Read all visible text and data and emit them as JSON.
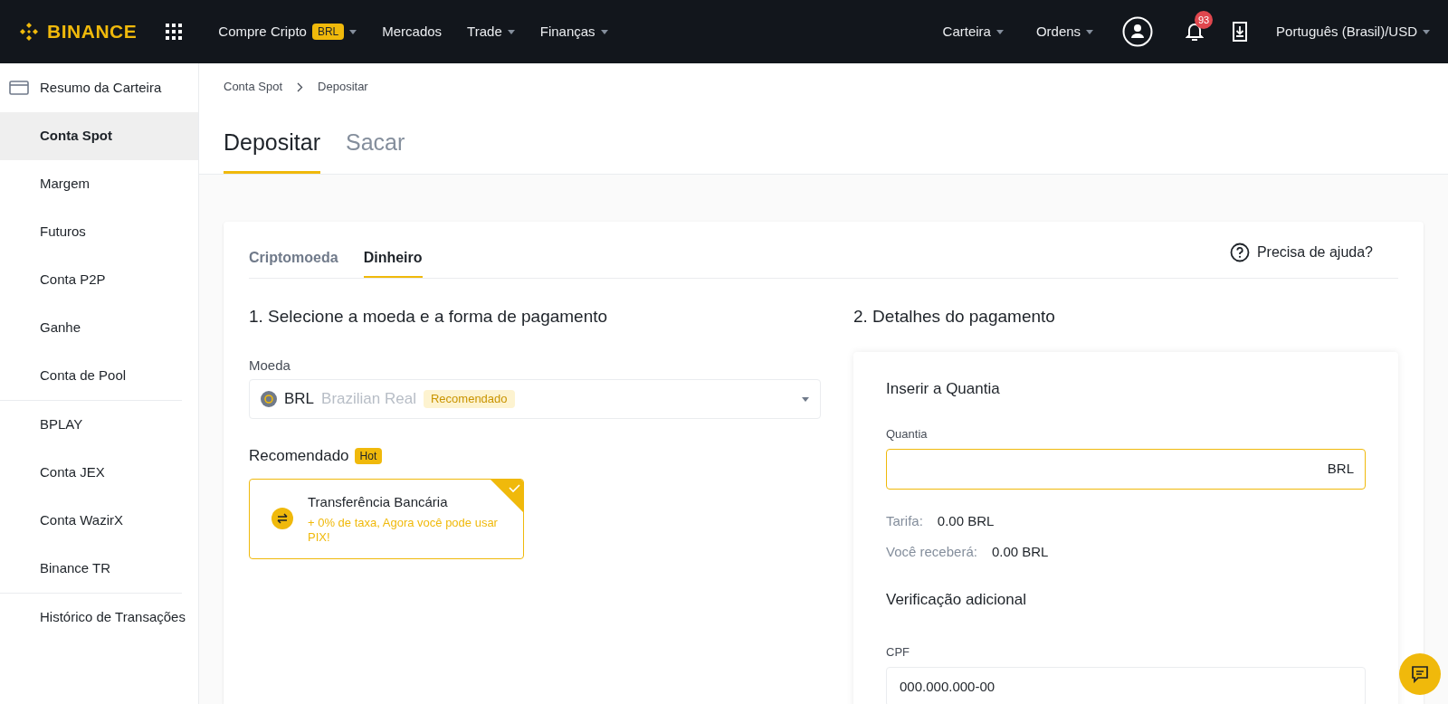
{
  "header": {
    "logo": "BINANCE",
    "nav": [
      {
        "label": "Compre Cripto",
        "badge": "BRL",
        "dropdown": true
      },
      {
        "label": "Mercados",
        "dropdown": false
      },
      {
        "label": "Trade",
        "dropdown": true
      },
      {
        "label": "Finanças",
        "dropdown": true
      }
    ],
    "right_nav": [
      {
        "label": "Carteira",
        "dropdown": true
      },
      {
        "label": "Ordens",
        "dropdown": true
      }
    ],
    "notification_count": "93",
    "language": {
      "label": "Português (Brasil)/USD",
      "dropdown": true
    }
  },
  "sidebar": {
    "summary": {
      "label": "Resumo da Carteira",
      "selected": false
    },
    "groups": [
      [
        {
          "label": "Conta Spot",
          "selected": true
        },
        {
          "label": "Margem",
          "selected": false
        },
        {
          "label": "Futuros",
          "selected": false
        },
        {
          "label": "Conta P2P",
          "selected": false
        },
        {
          "label": "Ganhe",
          "selected": false
        },
        {
          "label": "Conta de Pool",
          "selected": false
        }
      ],
      [
        {
          "label": "BPLAY",
          "selected": false
        },
        {
          "label": "Conta JEX",
          "selected": false
        },
        {
          "label": "Conta WazirX",
          "selected": false
        },
        {
          "label": "Binance TR",
          "selected": false
        }
      ],
      [
        {
          "label": "Histórico de Transações",
          "selected": false
        }
      ]
    ]
  },
  "breadcrumb": [
    "Conta Spot",
    "Depositar"
  ],
  "page_tabs": [
    {
      "label": "Depositar",
      "selected": true
    },
    {
      "label": "Sacar",
      "selected": false
    }
  ],
  "deposit": {
    "tabs": [
      {
        "label": "Criptomoeda",
        "selected": false
      },
      {
        "label": "Dinheiro",
        "selected": true
      }
    ],
    "help": "Precisa de ajuda?",
    "step1": {
      "title": "1. Selecione a moeda e a forma de pagamento",
      "currency_label": "Moeda",
      "currency": {
        "code": "BRL",
        "name": "Brazilian Real",
        "tag": "Recomendado"
      },
      "recommended_label": "Recomendado",
      "recommended_badge": "Hot",
      "methods": [
        {
          "title": "Transferência Bancária",
          "note": "+ 0% de taxa, Agora você pode usar PIX!",
          "selected": true
        }
      ]
    },
    "step2": {
      "title": "2. Detalhes do pagamento",
      "amount_title": "Inserir a Quantia",
      "amount_label": "Quantia",
      "amount_unit": "BRL",
      "fees": [
        {
          "label": "Tarifa:",
          "value": "0.00 BRL"
        },
        {
          "label": "Você receberá:",
          "value": "0.00 BRL"
        }
      ],
      "verification_title": "Verificação adicional",
      "cpf_label": "CPF",
      "cpf_value": "000.000.000-00"
    }
  }
}
